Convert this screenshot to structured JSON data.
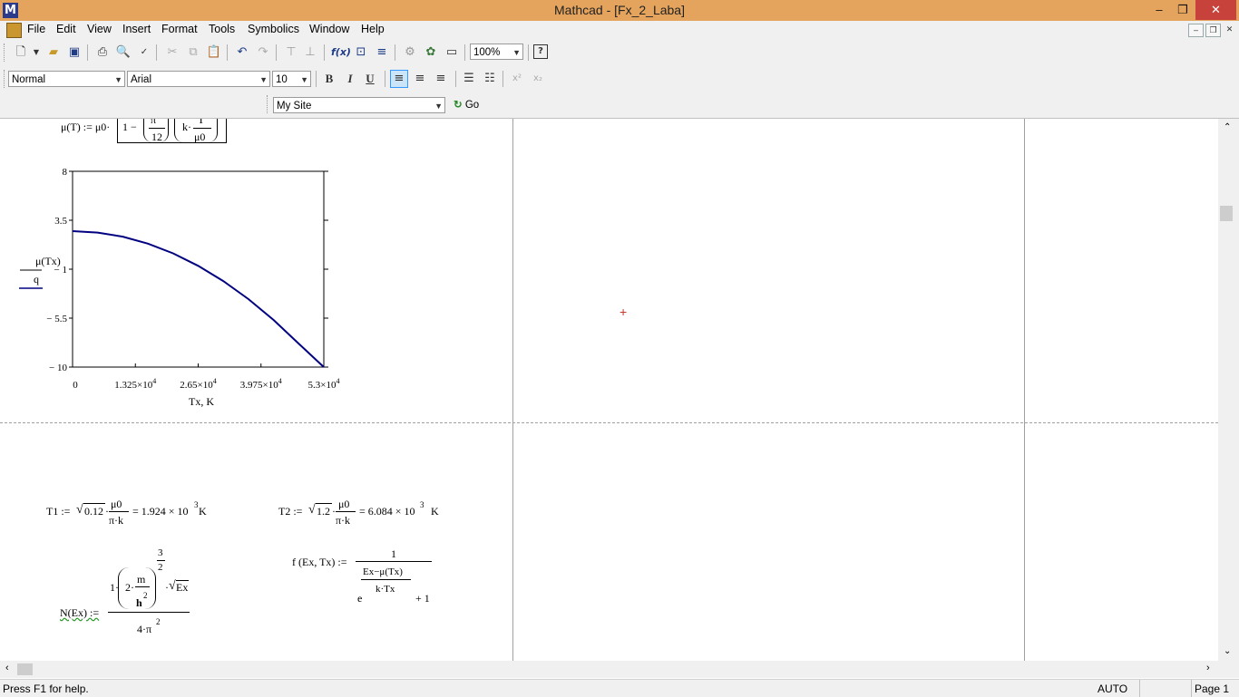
{
  "window": {
    "title": "Mathcad - [Fx_2_Laba]",
    "minimize": "–",
    "restore": "❐",
    "close": "✕"
  },
  "menu": [
    "File",
    "Edit",
    "View",
    "Insert",
    "Format",
    "Tools",
    "Symbolics",
    "Window",
    "Help"
  ],
  "toolbar": {
    "zoom": "100%",
    "style": "Normal",
    "font": "Arial",
    "size": "10",
    "bold": "B",
    "italic": "I",
    "underline": "U",
    "site": "My Site",
    "go": "Go"
  },
  "worksheet": {
    "mu_def": {
      "lhs": "μ(T) := μ0·",
      "one": "1 −",
      "pi_num": "π",
      "twelve": "12",
      "k": "k·",
      "t": "T",
      "mu0": "μ0"
    },
    "t1": {
      "lhs": "T1 :=",
      "coef": "0.12",
      "num": "μ0",
      "den": "π·k",
      "result": "= 1.924 × 10",
      "exp": "3",
      "unit": "K"
    },
    "t2": {
      "lhs": "T2 :=",
      "coef": "1.2",
      "num": "μ0",
      "den": "π·k",
      "result": "= 6.084 × 10",
      "exp": "3",
      "unit": "K"
    },
    "f_def": {
      "lhs": "f (Ex, Tx) :=",
      "num": "1",
      "exp_num": "Ex−μ(Tx)",
      "exp_den": "k·Tx",
      "e": "e",
      "plus": "+ 1"
    },
    "n_def": {
      "lhs": "N(Ex) :=",
      "one": "1·",
      "two": "2·",
      "m": "m",
      "h": "h",
      "h_exp": "2",
      "pow_num": "3",
      "pow_den": "2",
      "sqrt": "Ex",
      "den": "4·π",
      "den_exp": "2"
    }
  },
  "chart_data": {
    "type": "line",
    "ylabel_num": "μ(Tx)",
    "ylabel_den": "q",
    "xlabel": "Tx, K",
    "xlim": [
      0,
      53000
    ],
    "ylim": [
      -10,
      8
    ],
    "yticks": [
      "8",
      "3.5",
      "− 1",
      "− 5.5",
      "− 10"
    ],
    "ytick_values": [
      8,
      3.5,
      -1,
      -5.5,
      -10
    ],
    "xticks": [
      "0",
      "1.325×10",
      "2.65×10",
      "3.975×10",
      "5.3×10"
    ],
    "xtick_exp": [
      "",
      "4",
      "4",
      "4",
      "4"
    ],
    "xtick_values": [
      0,
      13250,
      26500,
      39750,
      53000
    ],
    "series": [
      {
        "color": "#000080",
        "x": [
          0,
          5300,
          10600,
          15900,
          21200,
          26500,
          31800,
          37100,
          42400,
          47700,
          53000
        ],
        "y": [
          2.5,
          2.37,
          1.99,
          1.35,
          0.46,
          -0.69,
          -2.09,
          -3.75,
          -5.67,
          -7.84,
          -10.0
        ]
      }
    ]
  },
  "status": {
    "help": "Press F1 for help.",
    "mode": "AUTO",
    "page": "Page 1"
  }
}
